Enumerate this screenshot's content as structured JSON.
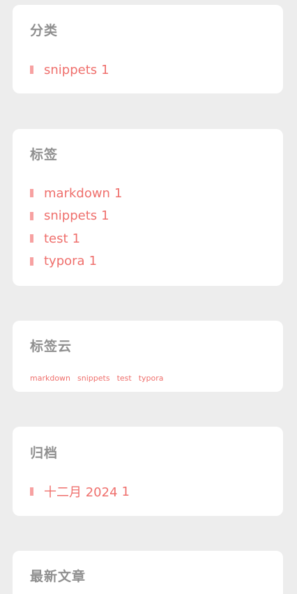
{
  "categories": {
    "title": "分类",
    "items": [
      {
        "label": "snippets",
        "count": "1"
      }
    ]
  },
  "tags": {
    "title": "标签",
    "items": [
      {
        "label": "markdown",
        "count": "1"
      },
      {
        "label": "snippets",
        "count": "1"
      },
      {
        "label": "test",
        "count": "1"
      },
      {
        "label": "typora",
        "count": "1"
      }
    ]
  },
  "tag_cloud": {
    "title": "标签云",
    "tags": [
      "markdown",
      "snippets",
      "test",
      "typora"
    ]
  },
  "archives": {
    "title": "归档",
    "items": [
      {
        "label": "十二月 2024",
        "count": "1"
      }
    ]
  },
  "recent_posts": {
    "title": "最新文章"
  },
  "colors": {
    "page_background": "#ededed",
    "card_background": "#ffffff",
    "title_text": "#8f8f8f",
    "link": "#ef6f6c",
    "bullet": "#f7a1a1"
  }
}
